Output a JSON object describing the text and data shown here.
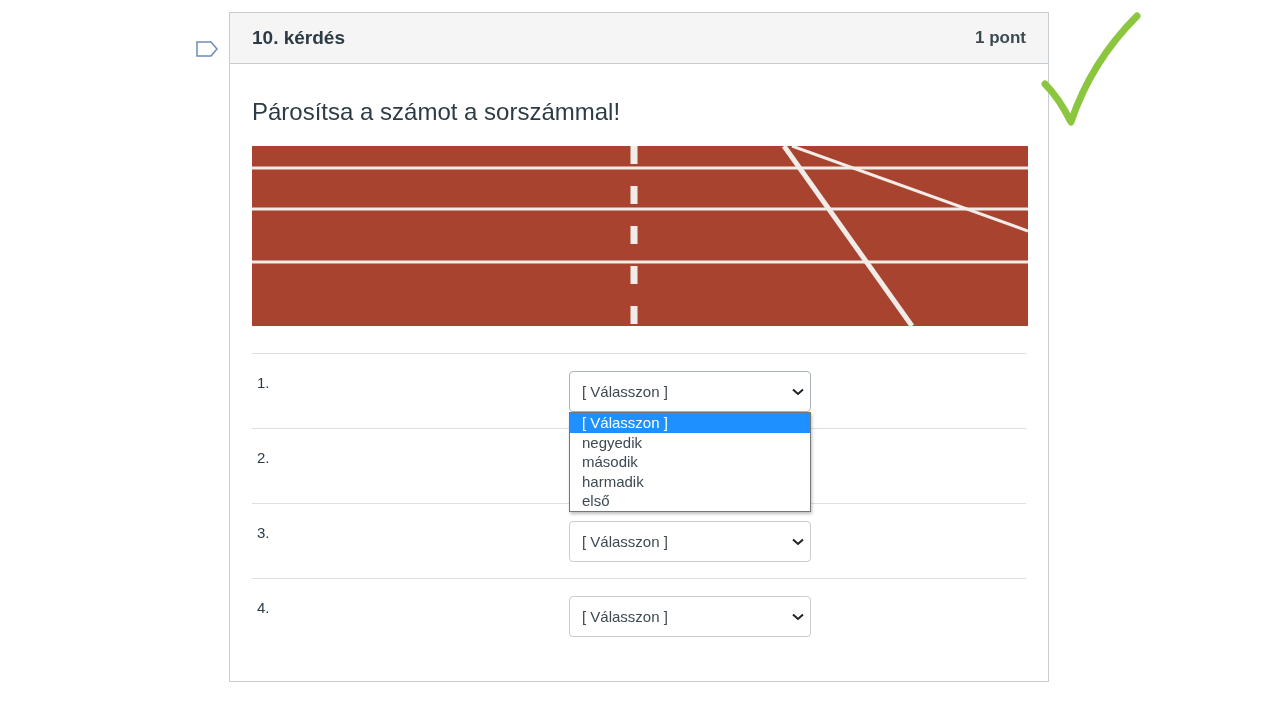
{
  "question": {
    "title": "10. kérdés",
    "points": "1 pont",
    "flagged": false,
    "text": "Párosítsa a számot a sorszámmal!",
    "correct": true
  },
  "rows": [
    {
      "number": "1.",
      "select": {
        "value": "[ Válasszon ]",
        "open": true
      }
    },
    {
      "number": "2."
    },
    {
      "number": "3.",
      "select": {
        "value": "[ Válasszon ]",
        "open": false
      }
    },
    {
      "number": "4.",
      "select": {
        "value": "[ Válasszon ]",
        "open": false
      }
    }
  ],
  "dropdown": {
    "options": [
      {
        "label": "[ Válasszon ]",
        "selected": true
      },
      {
        "label": "negyedik",
        "selected": false
      },
      {
        "label": "második",
        "selected": false
      },
      {
        "label": "harmadik",
        "selected": false
      },
      {
        "label": "első",
        "selected": false
      }
    ]
  }
}
